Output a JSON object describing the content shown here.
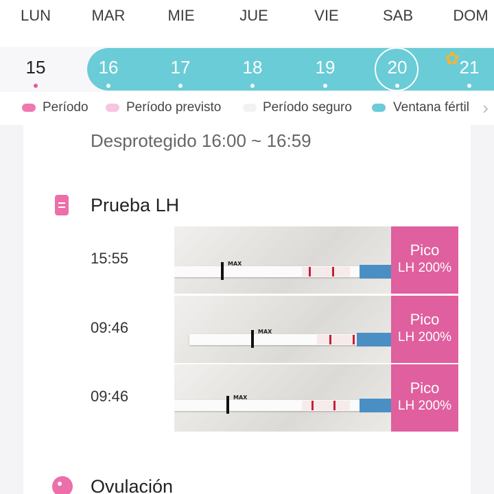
{
  "calendar": {
    "weekdays": [
      "LUN",
      "MAR",
      "MIE",
      "JUE",
      "VIE",
      "SAB",
      "DOM"
    ],
    "days": [
      {
        "num": "15",
        "state": "normal"
      },
      {
        "num": "16",
        "state": "fertile"
      },
      {
        "num": "17",
        "state": "fertile"
      },
      {
        "num": "18",
        "state": "fertile"
      },
      {
        "num": "19",
        "state": "fertile"
      },
      {
        "num": "20",
        "state": "selected"
      },
      {
        "num": "21",
        "state": "ovulation"
      }
    ]
  },
  "legend": [
    {
      "label": "Período",
      "color": "#ee79b0"
    },
    {
      "label": "Período previsto",
      "color": "#f7c5de"
    },
    {
      "label": "Período seguro",
      "color": "#f2f2f2"
    },
    {
      "label": "Ventana fértil",
      "color": "#69ccd6"
    }
  ],
  "intercourse": {
    "text": "Desprotegido 16:00 ~ 16:59"
  },
  "lh_section": {
    "title": "Prueba LH",
    "tests": [
      {
        "time": "15:55",
        "result": "Pico",
        "percent": "LH 200%"
      },
      {
        "time": "09:46",
        "result": "Pico",
        "percent": "LH 200%"
      },
      {
        "time": "09:46",
        "result": "Pico",
        "percent": "LH 200%"
      }
    ],
    "strip_label": "MAX"
  },
  "ovulation_section": {
    "title": "Ovulación"
  },
  "colors": {
    "fertile": "#69ccd6",
    "period": "#e05f9e",
    "accent_dot": "#e8579f"
  },
  "icons": {
    "ovulation_day": "flower-icon",
    "legend_more": "chevron-right-icon"
  }
}
